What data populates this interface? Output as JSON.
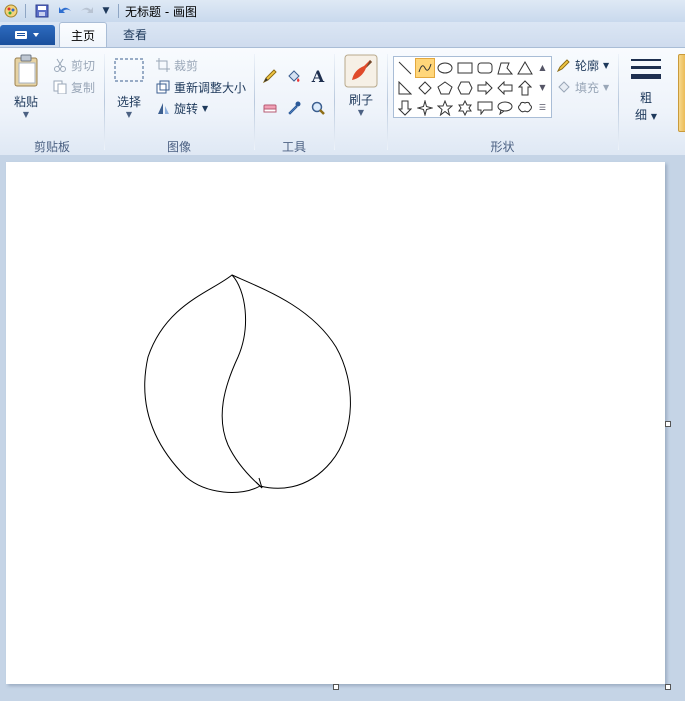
{
  "window": {
    "title": "无标题 - 画图"
  },
  "tabs": [
    {
      "label": "主页",
      "active": true
    },
    {
      "label": "查看",
      "active": false
    }
  ],
  "clipboard": {
    "paste_label": "粘贴",
    "cut_label": "剪切",
    "copy_label": "复制",
    "group_label": "剪贴板"
  },
  "image": {
    "select_label": "选择",
    "crop_label": "裁剪",
    "resize_label": "重新调整大小",
    "rotate_label": "旋转",
    "group_label": "图像"
  },
  "tools": {
    "group_label": "工具"
  },
  "brushes": {
    "label": "刷子"
  },
  "shapes": {
    "outline_label": "轮廓",
    "fill_label": "填充",
    "group_label": "形状",
    "selected": "curve-shape-icon"
  },
  "size": {
    "label_line1": "粗",
    "label_line2": "细"
  },
  "colors": {
    "accent": "#1a4f9c",
    "selection": "#ffd67a"
  }
}
